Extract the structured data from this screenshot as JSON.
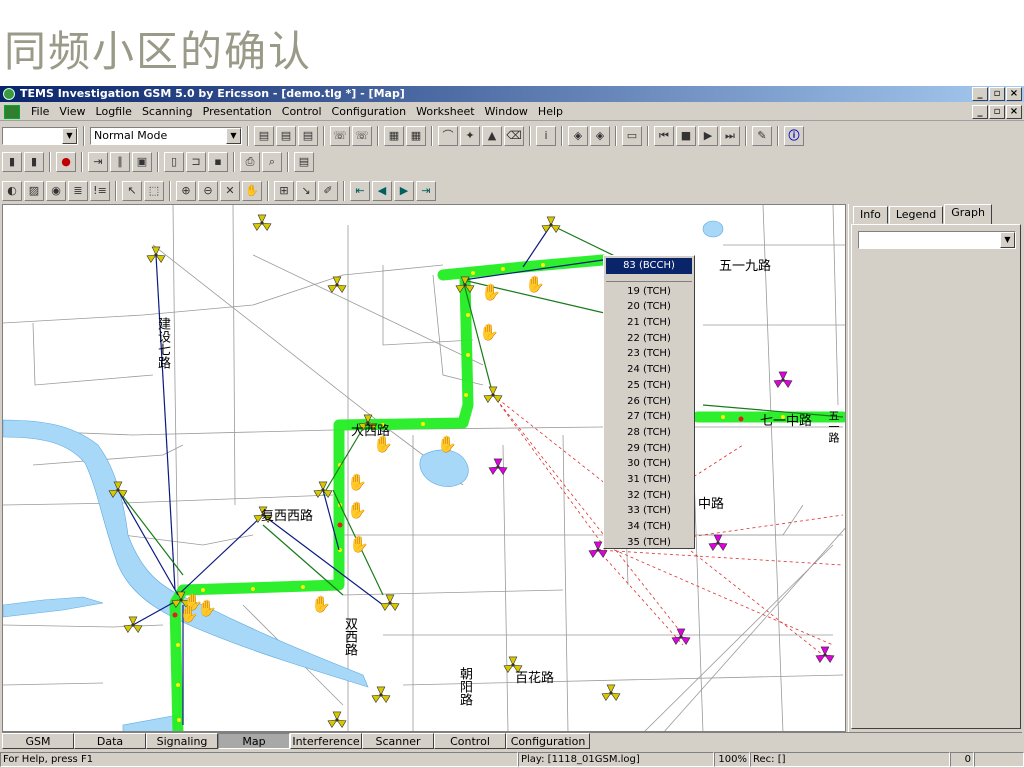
{
  "slide": {
    "title": "同频小区的确认"
  },
  "window": {
    "title": "TEMS Investigation GSM 5.0  by Ericsson - [demo.tlg *] - [Map]",
    "controls": [
      "_",
      "▫",
      "×"
    ]
  },
  "menu": {
    "items": [
      "File",
      "View",
      "Logfile",
      "Scanning",
      "Presentation",
      "Control",
      "Configuration",
      "Worksheet",
      "Window",
      "Help"
    ]
  },
  "toolbar": {
    "mode_combo_value": "Normal Mode",
    "empty_combo_value": ""
  },
  "map": {
    "streets": {
      "wuyijiu": "五一九路",
      "qiyizhong": "七一中路",
      "zhong": "中路",
      "dongdan": "大西路",
      "xi": "建设七路",
      "fuxi": "复西西路",
      "shuxi": "双西路",
      "baihua": "百花路",
      "chaoyang": "朝阳路",
      "hubei": "五一路"
    }
  },
  "channel_menu": {
    "selected": "83 (BCCH)",
    "items": [
      "19 (TCH)",
      "20 (TCH)",
      "21 (TCH)",
      "22 (TCH)",
      "23 (TCH)",
      "24 (TCH)",
      "25 (TCH)",
      "26 (TCH)",
      "27 (TCH)",
      "28 (TCH)",
      "29 (TCH)",
      "30 (TCH)",
      "31 (TCH)",
      "32 (TCH)",
      "33 (TCH)",
      "34 (TCH)",
      "35 (TCH)"
    ]
  },
  "side_panel": {
    "tabs": [
      "Info",
      "Legend",
      "Graph"
    ],
    "active_tab": "Graph",
    "graph_combo_value": ""
  },
  "bottom_tabs": {
    "items": [
      "GSM",
      "Data",
      "Signaling",
      "Map",
      "Interference",
      "Scanner",
      "Control",
      "Configuration"
    ],
    "active": "Map"
  },
  "status": {
    "help": "For Help, press F1",
    "play": "Play: [1118_01GSM.log]",
    "zoom": "100%",
    "rec": "Rec: []",
    "count": "0"
  },
  "colors": {
    "route_green": "#22ee22",
    "river_blue": "#a8d8f8",
    "site_yellow": "#d8c800",
    "site_magenta": "#e000e0",
    "selection_blue": "#0a246a"
  }
}
